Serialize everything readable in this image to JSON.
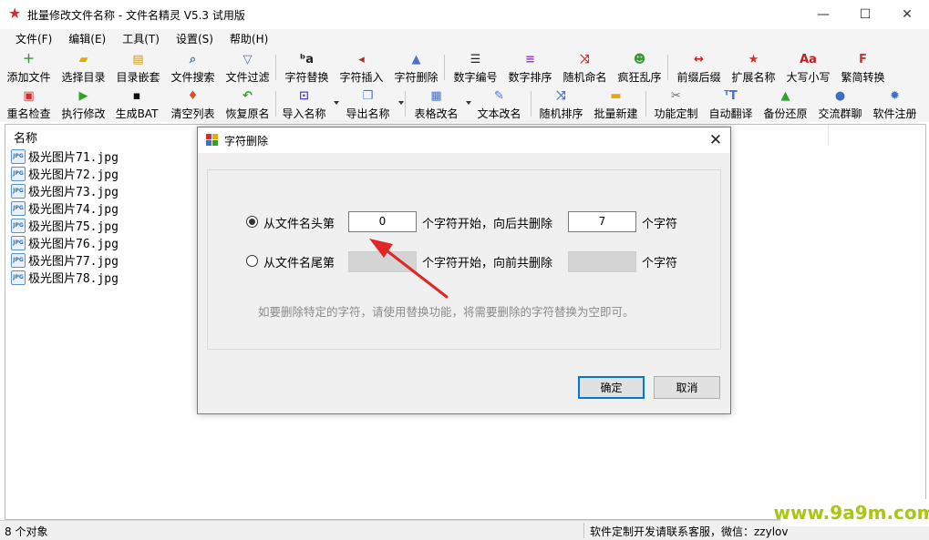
{
  "window": {
    "title": "批量修改文件名称 - 文件名精灵 V5.3 试用版",
    "minimize": "—",
    "maximize": "☐",
    "close": "✕"
  },
  "menu": [
    "文件(F)",
    "编辑(E)",
    "工具(T)",
    "设置(S)",
    "帮助(H)"
  ],
  "toolbar1": [
    {
      "label": "添加文件",
      "icon": "add-file-icon",
      "glyph": "＋",
      "color": "#3a9a3a"
    },
    {
      "label": "选择目录",
      "icon": "folder-open-icon",
      "glyph": "▰",
      "color": "#e8a900"
    },
    {
      "label": "目录嵌套",
      "icon": "nested-folder-icon",
      "glyph": "▤",
      "color": "#c89a2a"
    },
    {
      "label": "文件搜索",
      "icon": "search-icon",
      "glyph": "⌕",
      "color": "#3a6fc4"
    },
    {
      "label": "文件过滤",
      "icon": "filter-icon",
      "glyph": "▽",
      "color": "#3a6fc4"
    },
    {
      "label": "字符替换",
      "icon": "char-replace-icon",
      "glyph": "ᵇa",
      "color": "#222222"
    },
    {
      "label": "字符插入",
      "icon": "char-insert-icon",
      "glyph": "◂",
      "color": "#b03030"
    },
    {
      "label": "字符删除",
      "icon": "char-delete-icon",
      "glyph": "▲",
      "color": "#4a6fd0"
    },
    {
      "label": "数字编号",
      "icon": "number-list-icon",
      "glyph": "☰",
      "color": "#222222"
    },
    {
      "label": "数字排序",
      "icon": "sort-icon",
      "glyph": "≡",
      "color": "#9b3fd0"
    },
    {
      "label": "随机命名",
      "icon": "shuffle-icon",
      "glyph": "⤨",
      "color": "#d03030"
    },
    {
      "label": "疯狂乱序",
      "icon": "crazy-shuffle-icon",
      "glyph": "☻",
      "color": "#3a9a3a"
    },
    {
      "label": "前缀后缀",
      "icon": "prefix-suffix-icon",
      "glyph": "↔",
      "color": "#c02020"
    },
    {
      "label": "扩展名称",
      "icon": "star-icon",
      "glyph": "★",
      "color": "#d03030"
    },
    {
      "label": "大写小写",
      "icon": "case-icon",
      "glyph": "Aa",
      "color": "#c02020"
    },
    {
      "label": "繁简转换",
      "icon": "convert-icon",
      "glyph": "F",
      "color": "#d03030"
    }
  ],
  "toolbar2": [
    {
      "label": "重名检查",
      "icon": "duplicate-check-icon",
      "glyph": "▣",
      "color": "#d03030"
    },
    {
      "label": "执行修改",
      "icon": "play-icon",
      "glyph": "▶",
      "color": "#2aa52a"
    },
    {
      "label": "生成BAT",
      "icon": "terminal-icon",
      "glyph": "▪",
      "color": "#111111"
    },
    {
      "label": "清空列表",
      "icon": "clear-list-icon",
      "glyph": "♦",
      "color": "#e0502a"
    },
    {
      "label": "恢复原名",
      "icon": "undo-icon",
      "glyph": "↶",
      "color": "#2aa52a"
    },
    {
      "label": "导入名称",
      "icon": "import-icon",
      "glyph": "⊡",
      "color": "#4a4ad0"
    },
    {
      "label": "导出名称",
      "icon": "export-icon",
      "glyph": "❐",
      "color": "#4a6fd0"
    },
    {
      "label": "表格改名",
      "icon": "table-icon",
      "glyph": "▦",
      "color": "#4a6fd0"
    },
    {
      "label": "文本改名",
      "icon": "text-edit-icon",
      "glyph": "✎",
      "color": "#4a6fd0"
    },
    {
      "label": "随机排序",
      "icon": "random-sort-icon",
      "glyph": "⤨",
      "color": "#4a6fd0"
    },
    {
      "label": "批量新建",
      "icon": "new-folder-icon",
      "glyph": "▬",
      "color": "#e8a900"
    },
    {
      "label": "功能定制",
      "icon": "tools-icon",
      "glyph": "✂",
      "color": "#666666"
    },
    {
      "label": "自动翻译",
      "icon": "translate-icon",
      "glyph": "ᵀT",
      "color": "#4a6fd0"
    },
    {
      "label": "备份还原",
      "icon": "drive-icon",
      "glyph": "▲",
      "color": "#2aa52a"
    },
    {
      "label": "交流群聊",
      "icon": "chat-icon",
      "glyph": "●",
      "color": "#3a6fc4"
    },
    {
      "label": "软件注册",
      "icon": "register-gear-icon",
      "glyph": "✹",
      "color": "#3a6fc4"
    }
  ],
  "file_list": {
    "header": "名称",
    "icon_text": "JPG",
    "files": [
      "极光图片71.jpg",
      "极光图片72.jpg",
      "极光图片73.jpg",
      "极光图片74.jpg",
      "极光图片75.jpg",
      "极光图片76.jpg",
      "极光图片77.jpg",
      "极光图片78.jpg"
    ]
  },
  "status": {
    "count": "8 个对象",
    "contact": "软件定制开发请联系客服，微信：zzylov"
  },
  "watermark": "www.9a9m.com",
  "dialog": {
    "title": "字符删除",
    "close": "✕",
    "option1": {
      "label": "从文件名头第",
      "start_value": "0",
      "mid_text": "个字符开始，向后共删除",
      "count_value": "7",
      "end_text": "个字符",
      "selected": true
    },
    "option2": {
      "label": "从文件名尾第",
      "start_value": "",
      "mid_text": "个字符开始，向前共删除",
      "count_value": "",
      "end_text": "个字符",
      "selected": false
    },
    "hint": "如要删除特定的字符，请使用替换功能，将需要删除的字符替换为空即可。",
    "ok": "确定",
    "cancel": "取消"
  },
  "colors": {
    "accent": "#0078d7",
    "annotation_arrow": "#e02626",
    "watermark": "#a8c80f"
  }
}
